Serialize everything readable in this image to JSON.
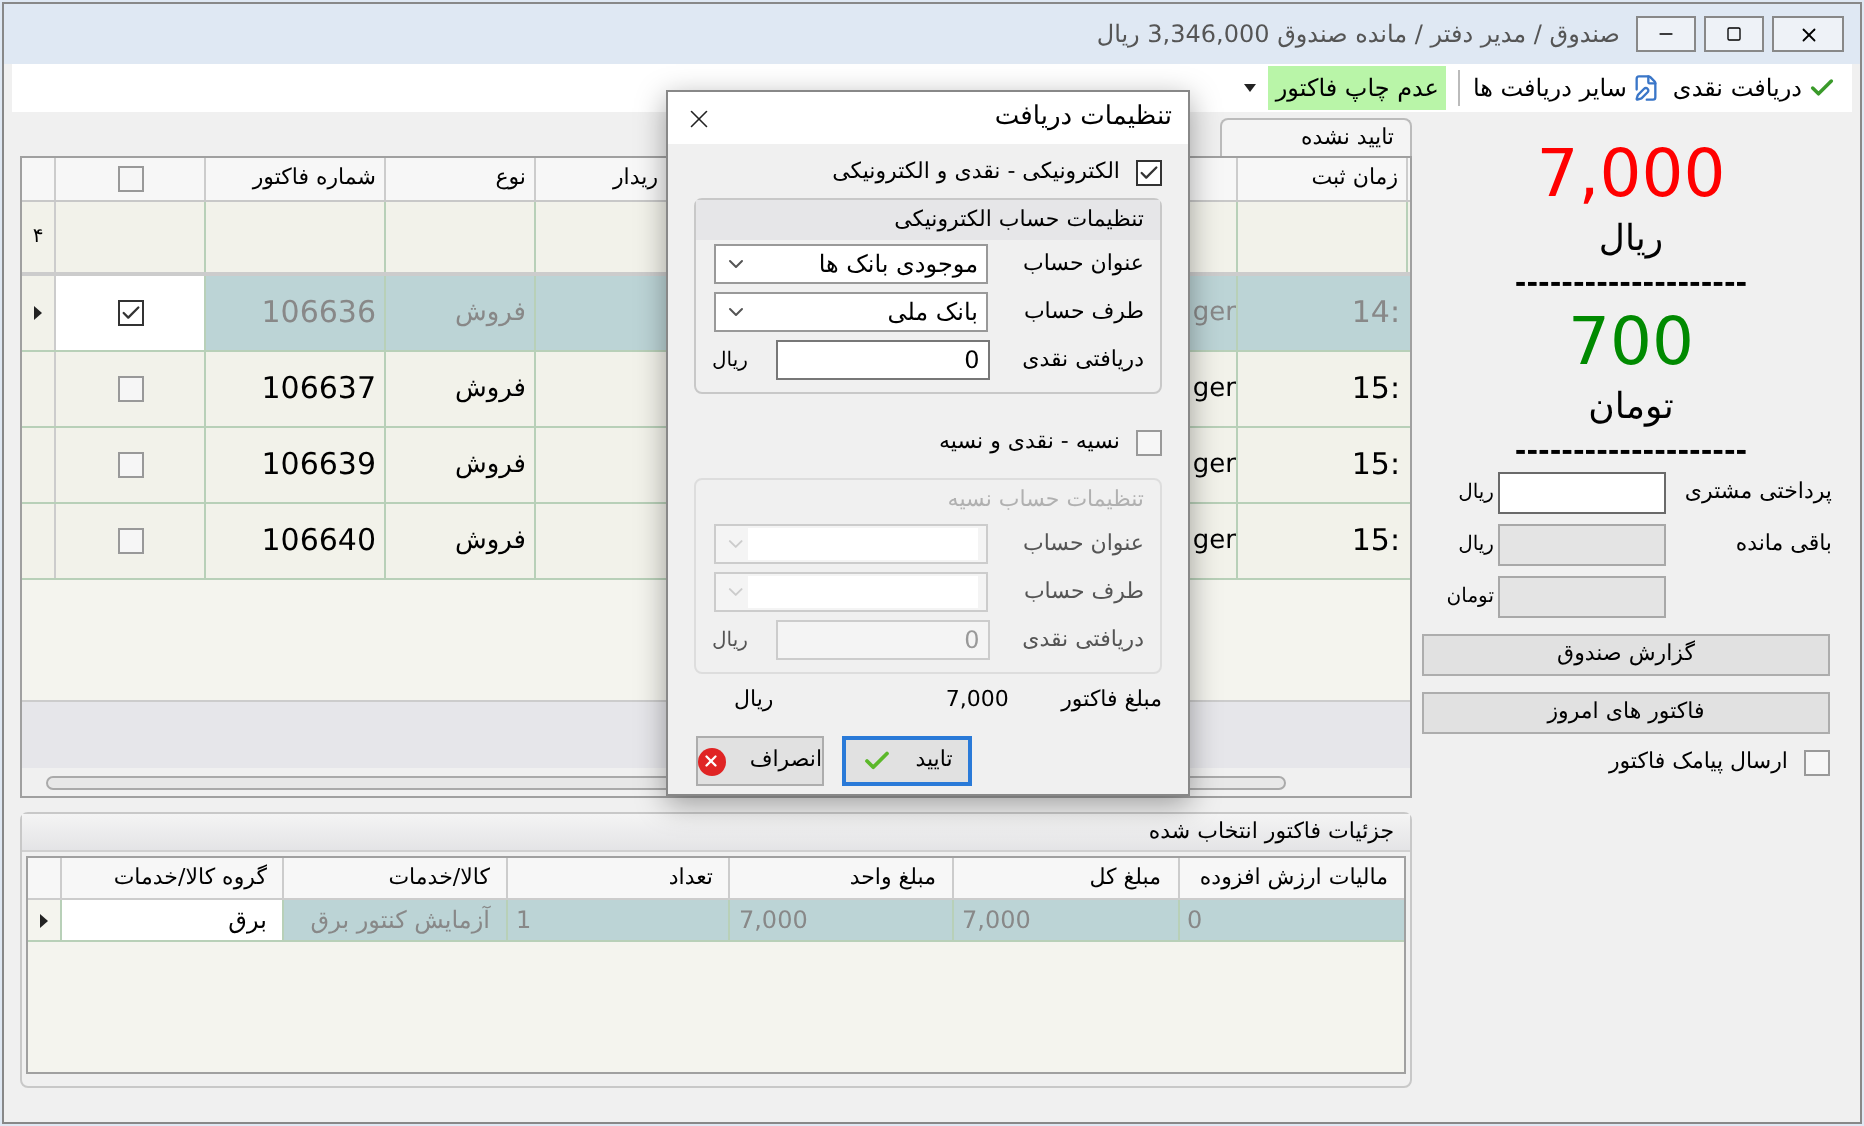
{
  "window": {
    "title": "صندوق / مدیر دفتر / مانده صندوق 3,346,000 ریال"
  },
  "toolbar": {
    "items": [
      {
        "label": "دریافت نقدی",
        "kind": "check"
      },
      {
        "label": "سایر دریافت ها",
        "kind": "document"
      }
    ],
    "print_toggle": {
      "label": "عدم چاپ فاکتور",
      "on": true
    }
  },
  "pending_invoices": {
    "title": "تایید نشده",
    "columns": [
      "زمان ثبت",
      "ریدار",
      "نوع",
      "شماره فاکتور"
    ],
    "select_all": {
      "checked": false
    },
    "filter_marker": "۴",
    "rows": [
      {
        "selected": true,
        "checked": true,
        "number": "106636",
        "type": "فروش",
        "column_5": "ger",
        "time": "14:"
      },
      {
        "selected": false,
        "checked": false,
        "number": "106637",
        "type": "فروش",
        "column_5": "ger",
        "time": "15:"
      },
      {
        "selected": false,
        "checked": false,
        "number": "106639",
        "type": "فروش",
        "column_5": "ger",
        "time": "15:"
      },
      {
        "selected": false,
        "checked": false,
        "number": "106640",
        "type": "فروش",
        "column_5": "ger",
        "time": "15:"
      }
    ]
  },
  "details": {
    "title": "جزئیات فاکتور انتخاب شده",
    "columns": [
      "مالیات ارزش افزوده",
      "مبلغ کل",
      "مبلغ واحد",
      "تعداد",
      "کالا/خدمات",
      "گروه کالا/خدمات"
    ],
    "rows": [
      {
        "selected": true,
        "cells": [
          "0",
          "7,000",
          "7,000",
          "1",
          "آزمایش کنتور برق",
          "برق"
        ]
      }
    ]
  },
  "summary": {
    "amount_rial": "7,000",
    "rial_label": "ریال",
    "separator_1": "--------------------",
    "amount_toman": "700",
    "toman_label": "تومان",
    "separator_2": "--------------------",
    "fields": [
      {
        "label": "پرداختی مشتری",
        "unit": "ریال",
        "disabled": false
      },
      {
        "label": "باقی مانده",
        "unit": "ریال",
        "disabled": true
      },
      {
        "unit": "تومان",
        "disabled": true
      }
    ],
    "buttons": [
      "گزارش صندوق",
      "فاکتور های امروز"
    ],
    "sms": {
      "label": "ارسال پیامک فاکتور",
      "checked": false
    }
  },
  "dialog": {
    "title": "تنظیمات دریافت",
    "electronic": {
      "label": "الکترونیکی - نقدی و الکترونیکی",
      "checked": true
    },
    "electronic_group": {
      "title": "تنظیمات حساب الکترونیکی",
      "disabled": false,
      "account_title_label": "عنوان حساب",
      "account_title_value": "موجودی بانک ها",
      "account_side_label": "طرف حساب",
      "account_side_value": "بانک ملی",
      "cash_label": "دریافتی نقدی",
      "cash_value": "0",
      "cash_unit": "ریال"
    },
    "credit": {
      "label": "نسیه - نقدی و نسیه",
      "checked": false
    },
    "credit_group": {
      "title": "تنظیمات حساب نسیه",
      "disabled": true,
      "account_title_label": "عنوان حساب",
      "account_side_label": "طرف حساب",
      "cash_label": "دریافتی نقدی",
      "cash_value": "0",
      "cash_unit": "ریال"
    },
    "invoice_amount": {
      "label": "مبلغ فاکتور",
      "value": "7,000",
      "unit": "ریال"
    },
    "buttons": [
      {
        "label": "تایید",
        "kind": "confirm",
        "focused": true
      },
      {
        "label": "انصراف",
        "kind": "cancel",
        "focused": false
      }
    ]
  }
}
